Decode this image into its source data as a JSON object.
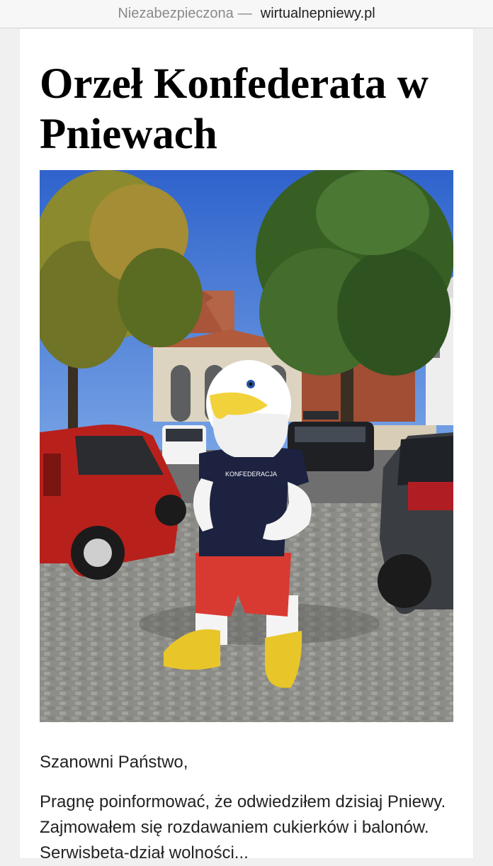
{
  "browser": {
    "security_label": "Niezabezpieczona",
    "separator": "—",
    "domain": "wirtualnepniewy.pl"
  },
  "article": {
    "title": "Orzeł Konfederata w Pniewach",
    "hero_image": {
      "mascot_shirt_text": "KONFEDERACJA"
    },
    "greeting": "Szanowni Państwo,",
    "paragraph": "Pragnę poinformować, że odwiedziłem dzisiaj Pniewy. Zajmowałem się rozdawaniem cukierków i balonów. Serwisbeta-dział wolności..."
  },
  "colors": {
    "sky": "#3f75d6",
    "brick": "#a8553a",
    "tree_green": "#3e6a2a",
    "tree_autumn": "#8a8a2c",
    "car_red": "#b8201c",
    "car_dark": "#3a3d42",
    "cobble": "#8c8c88",
    "mascot_shirt": "#1c2240",
    "mascot_shorts": "#d83a32",
    "beak": "#f2d23a"
  }
}
